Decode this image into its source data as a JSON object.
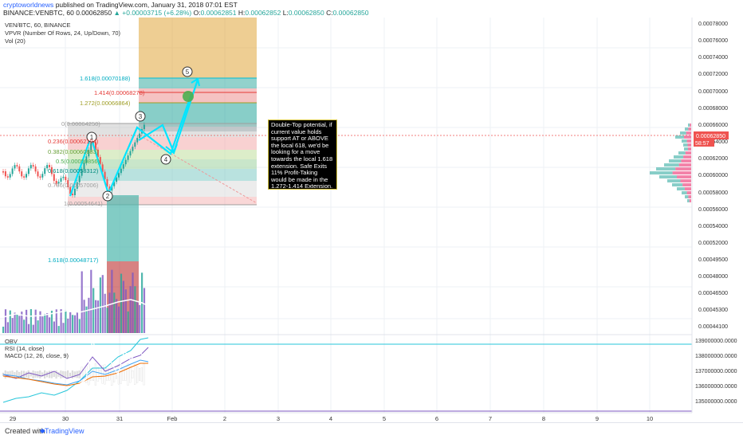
{
  "header": {
    "author": "cryptoworldnews",
    "published": "published on TradingView.com, January 31, 2018 07:01 EST",
    "symbol": "BINANCE:VENBTC, 60",
    "price": "0.00062850",
    "change": "+0.00003715 (+6.28%)",
    "o_label": "O:",
    "o_value": "0.00062851",
    "h_label": "H:",
    "h_value": "0.00062852",
    "l_label": "L:",
    "l_value": "0.00062850",
    "c_label": "C:",
    "c_value": "0.00062850"
  },
  "legend": {
    "symbol": "VEN/BTC, 60, BINANCE",
    "vpvr": "VPVR (Number Of Rows, 24, Up/Down, 70)",
    "vol": "Vol (20)"
  },
  "sub_legend": {
    "obv": "OBV",
    "rsi": "RSI (14, close)",
    "macd": "MACD (12, 26, close, 9)"
  },
  "price_axis": [
    "0.00078000",
    "0.00076000",
    "0.00074000",
    "0.00072000",
    "0.00070000",
    "0.00068000",
    "0.00066000",
    "0.00064000",
    "0.00062000",
    "0.00060000",
    "0.00058000",
    "0.00056000",
    "0.00054000",
    "0.00052000",
    "0.00049500",
    "0.00048000",
    "0.00046500",
    "0.00045300",
    "0.00044100",
    "0.00043000",
    "0.00041950"
  ],
  "current_price_label": "0.00062850",
  "countdown_label": "58:57",
  "obv_axis": [
    "139000000.0000",
    "138000000.0000",
    "137000000.0000",
    "136000000.0000",
    "135000000.0000"
  ],
  "time_axis": [
    "29",
    "30",
    "31",
    "Feb",
    "2",
    "3",
    "4",
    "5",
    "6",
    "7",
    "8",
    "9",
    "10"
  ],
  "fib_upper": [
    {
      "label": "1.618(0.00070188)",
      "color": "#00bcd4"
    },
    {
      "label": "1.414(0.00068278)",
      "color": "#e53935"
    },
    {
      "label": "1.272(0.00066864)",
      "color": "#9e9d24"
    }
  ],
  "fib_left": [
    {
      "label": "0(0.00064250)",
      "color": "#9e9e9e"
    },
    {
      "label": "0.236(0.00062194)",
      "color": "#e53935"
    },
    {
      "label": "0.382(0.00060883)",
      "color": "#689f38"
    },
    {
      "label": "0.5(0.00059856)",
      "color": "#4caf50"
    },
    {
      "label": "0.618(0.00058312)",
      "color": "#00897b"
    },
    {
      "label": "0.786(0.00057006)",
      "color": "#9e9e9e"
    },
    {
      "label": "1(0.00054641)",
      "color": "#9e9e9e"
    }
  ],
  "fib_lower": {
    "label": "1.618(0.00048717)",
    "color": "#00bcd4"
  },
  "waves": [
    "1",
    "2",
    "3",
    "4",
    "5"
  ],
  "note": "Double-Top potential, if current value holds support AT or ABOVE the local 618, we'd be looking for a move towards the local 1.618 extension. Safe Exits 11% Profit-Taking would be made in the 1.272-1.414 Extension.",
  "footer": {
    "created": "Created with",
    "brand": "TradingView"
  },
  "colors": {
    "up": "#26a69a",
    "down": "#ef5350",
    "arrow": "#00e5ff",
    "note_border": "#d4c13a",
    "accent": "#2962ff"
  }
}
